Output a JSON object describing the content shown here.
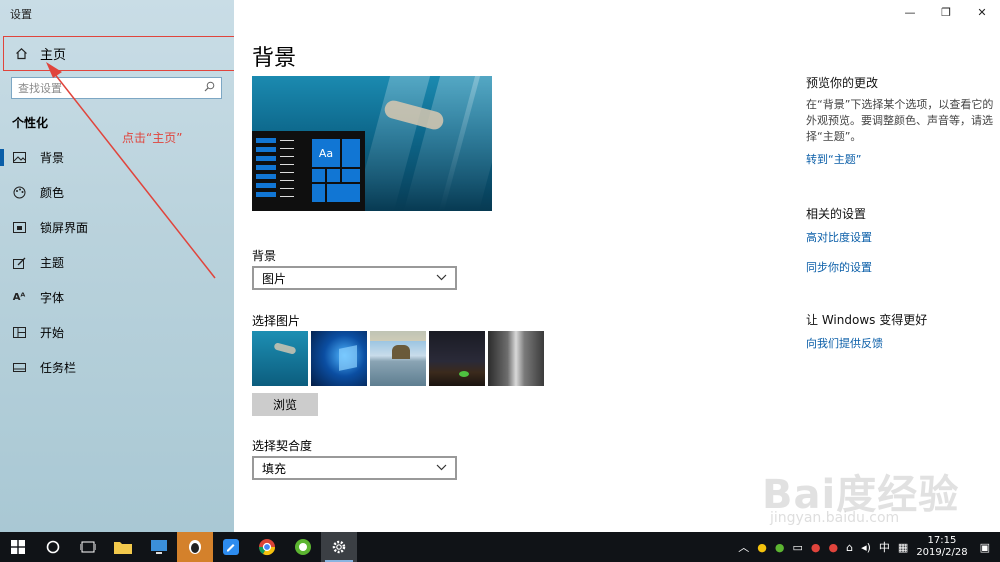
{
  "window": {
    "app_title": "设置",
    "controls": {
      "minimize": "—",
      "maximize": "❐",
      "close": "✕"
    }
  },
  "sidebar": {
    "home_label": "主页",
    "search_placeholder": "查找设置",
    "section_title": "个性化",
    "items": [
      {
        "label": "背景",
        "icon": "picture-icon",
        "active": true
      },
      {
        "label": "颜色",
        "icon": "palette-icon"
      },
      {
        "label": "锁屏界面",
        "icon": "lock-screen-icon"
      },
      {
        "label": "主题",
        "icon": "theme-brush-icon"
      },
      {
        "label": "字体",
        "icon": "font-icon"
      },
      {
        "label": "开始",
        "icon": "start-grid-icon"
      },
      {
        "label": "任务栏",
        "icon": "taskbar-icon"
      }
    ]
  },
  "annotation": "点击“主页”",
  "main": {
    "page_title": "背景",
    "preview_tile_text": "Aa",
    "background_label": "背景",
    "background_value": "图片",
    "choose_picture_label": "选择图片",
    "browse_label": "浏览",
    "fit_label": "选择契合度",
    "fit_value": "填充"
  },
  "right_panel": {
    "preview_title": "预览你的更改",
    "preview_text": "在“背景”下选择某个选项，以查看它的外观预览。要调整颜色、声音等，请选择“主题”。",
    "themes_link": "转到“主题”",
    "related_title": "相关的设置",
    "related_links": [
      "高对比度设置",
      "同步你的设置"
    ],
    "improve_title": "让 Windows 变得更好",
    "feedback_link": "向我们提供反馈"
  },
  "taskbar": {
    "clock_time": "17:15",
    "clock_date": "2019/2/28",
    "ime": "中"
  },
  "watermark": {
    "text": "Bai度经验",
    "url": "jingyan.baidu.com"
  },
  "colors": {
    "accent": "#0a5ea8",
    "annotation": "#e0443c",
    "tile_blue": "#1176d4"
  }
}
